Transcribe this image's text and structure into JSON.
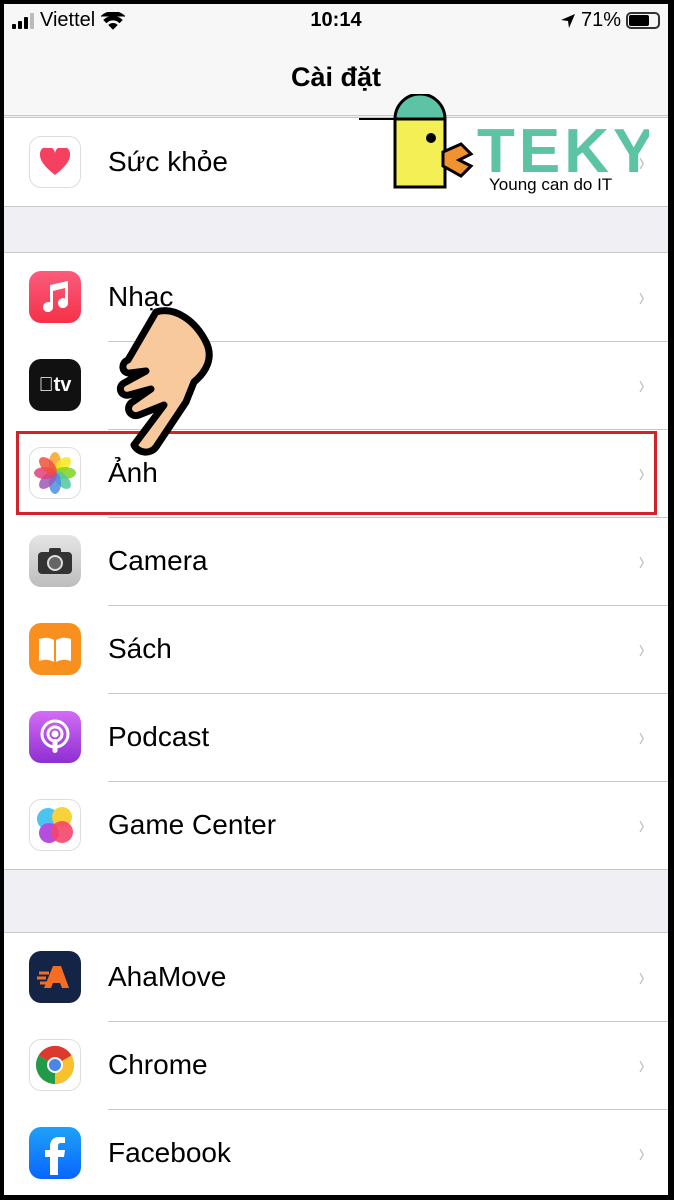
{
  "status": {
    "carrier": "Viettel",
    "time": "10:14",
    "battery": "71%",
    "battery_level": 0.71
  },
  "nav": {
    "title": "Cài đặt"
  },
  "groups": [
    [
      {
        "label": "Sức khỏe",
        "icon": "health-icon"
      }
    ],
    [
      {
        "label": "Nhạc",
        "icon": "music-icon"
      },
      {
        "label": "",
        "icon": "apple-tv-icon"
      },
      {
        "label": "Ảnh",
        "icon": "photos-icon",
        "highlighted": true
      },
      {
        "label": "Camera",
        "icon": "camera-icon"
      },
      {
        "label": "Sách",
        "icon": "books-icon"
      },
      {
        "label": "Podcast",
        "icon": "podcast-icon"
      },
      {
        "label": "Game Center",
        "icon": "game-center-icon"
      }
    ],
    [
      {
        "label": "AhaMove",
        "icon": "ahamove-icon"
      },
      {
        "label": "Chrome",
        "icon": "chrome-icon"
      },
      {
        "label": "Facebook",
        "icon": "facebook-icon"
      }
    ]
  ],
  "watermark": {
    "brand": "TEKY",
    "tagline": "Young can do IT"
  },
  "colors": {
    "highlight": "#d0232a",
    "teky": "#5cc3a5"
  }
}
